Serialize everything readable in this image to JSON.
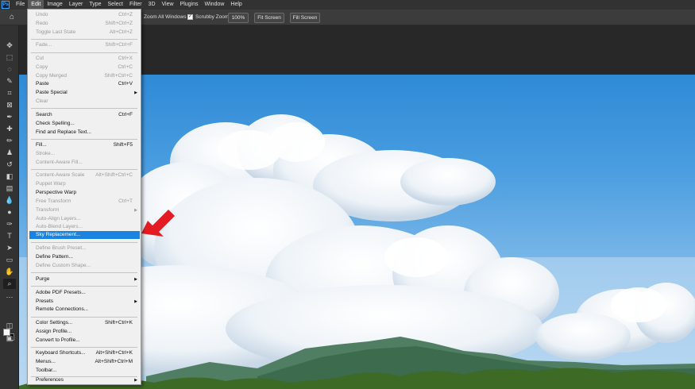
{
  "app": {
    "logo": "Ps"
  },
  "menubar": {
    "items": [
      "File",
      "Edit",
      "Image",
      "Layer",
      "Type",
      "Select",
      "Filter",
      "3D",
      "View",
      "Plugins",
      "Window",
      "Help"
    ]
  },
  "options": {
    "zoom_all_windows": "Zoom All Windows",
    "scrubby_zoom": "Scrubby Zoom",
    "zoom_100": "100%",
    "fit_screen": "Fit Screen",
    "fill_screen": "Fill Screen"
  },
  "edit_menu": {
    "undo": {
      "label": "Undo",
      "shortcut": "Ctrl+Z"
    },
    "redo": {
      "label": "Redo",
      "shortcut": "Shift+Ctrl+Z"
    },
    "toggle_last_state": {
      "label": "Toggle Last State",
      "shortcut": "Alt+Ctrl+Z"
    },
    "fade": {
      "label": "Fade...",
      "shortcut": "Shift+Ctrl+F"
    },
    "cut": {
      "label": "Cut",
      "shortcut": "Ctrl+X"
    },
    "copy": {
      "label": "Copy",
      "shortcut": "Ctrl+C"
    },
    "copy_merged": {
      "label": "Copy Merged",
      "shortcut": "Shift+Ctrl+C"
    },
    "paste": {
      "label": "Paste",
      "shortcut": "Ctrl+V"
    },
    "paste_special": {
      "label": "Paste Special"
    },
    "clear": {
      "label": "Clear"
    },
    "search": {
      "label": "Search",
      "shortcut": "Ctrl+F"
    },
    "check_spelling": {
      "label": "Check Spelling..."
    },
    "find_replace": {
      "label": "Find and Replace Text..."
    },
    "fill": {
      "label": "Fill...",
      "shortcut": "Shift+F5"
    },
    "stroke": {
      "label": "Stroke..."
    },
    "content_aware_fill": {
      "label": "Content-Aware Fill..."
    },
    "content_aware_scale": {
      "label": "Content-Aware Scale",
      "shortcut": "Alt+Shift+Ctrl+C"
    },
    "puppet_warp": {
      "label": "Puppet Warp"
    },
    "perspective_warp": {
      "label": "Perspective Warp"
    },
    "free_transform": {
      "label": "Free Transform",
      "shortcut": "Ctrl+T"
    },
    "transform": {
      "label": "Transform"
    },
    "auto_align": {
      "label": "Auto-Align Layers..."
    },
    "auto_blend": {
      "label": "Auto-Blend Layers..."
    },
    "sky_replacement": {
      "label": "Sky Replacement..."
    },
    "define_brush": {
      "label": "Define Brush Preset..."
    },
    "define_pattern": {
      "label": "Define Pattern..."
    },
    "define_custom_shape": {
      "label": "Define Custom Shape..."
    },
    "purge": {
      "label": "Purge"
    },
    "adobe_pdf_presets": {
      "label": "Adobe PDF Presets..."
    },
    "presets": {
      "label": "Presets"
    },
    "remote_connections": {
      "label": "Remote Connections..."
    },
    "color_settings": {
      "label": "Color Settings...",
      "shortcut": "Shift+Ctrl+K"
    },
    "assign_profile": {
      "label": "Assign Profile..."
    },
    "convert_profile": {
      "label": "Convert to Profile..."
    },
    "keyboard_shortcuts": {
      "label": "Keyboard Shortcuts...",
      "shortcut": "Alt+Shift+Ctrl+K"
    },
    "menus": {
      "label": "Menus...",
      "shortcut": "Alt+Shift+Ctrl+M"
    },
    "toolbar": {
      "label": "Toolbar..."
    },
    "preferences": {
      "label": "Preferences"
    }
  },
  "colors": {
    "highlight": "#1a82e0",
    "arrow": "#e31c23",
    "menu_bg": "#f0f0f0"
  },
  "icons": [
    "home-icon",
    "move-tool-icon",
    "marquee-tool-icon",
    "lasso-tool-icon",
    "quick-select-icon",
    "crop-tool-icon",
    "frame-tool-icon",
    "eyedropper-icon",
    "healing-brush-icon",
    "brush-tool-icon",
    "clone-stamp-icon",
    "history-brush-icon",
    "eraser-icon",
    "gradient-icon",
    "blur-icon",
    "dodge-icon",
    "pen-tool-icon",
    "type-tool-icon",
    "path-select-icon",
    "rectangle-tool-icon",
    "hand-tool-icon",
    "zoom-tool-icon",
    "arrow-pointer-icon",
    "submenu-arrow-icon"
  ]
}
